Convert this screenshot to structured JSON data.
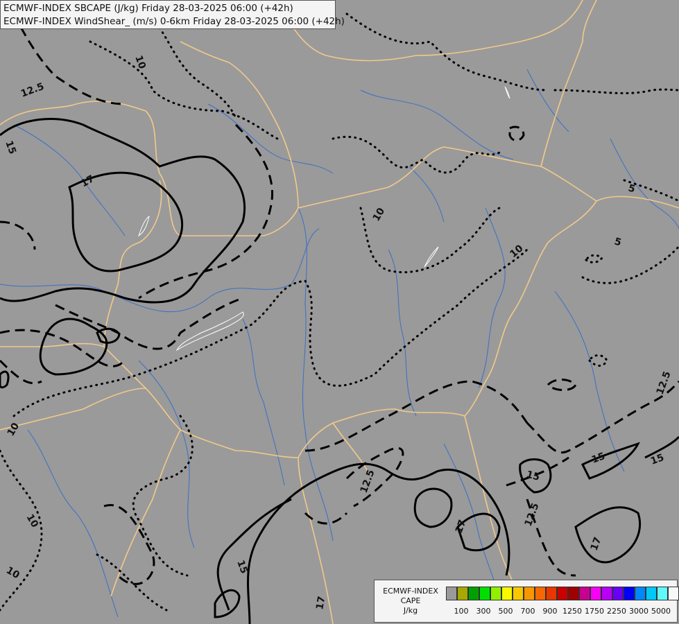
{
  "header": {
    "line1": "ECMWF-INDEX SBCAPE (J/kg) Friday 28-03-2025 06:00 (+42h)",
    "line2": "ECMWF-INDEX WindShear_ (m/s) 0-6km Friday 28-03-2025 06:00 (+42h)"
  },
  "contour_labels": [
    "10",
    "12.5",
    "15",
    "17",
    "10",
    "10",
    "5",
    "5",
    "12.5",
    "15",
    "15",
    "17",
    "15",
    "17",
    "12.5",
    "12.5",
    "17",
    "15",
    "17",
    "10",
    "10",
    "10"
  ],
  "legend": {
    "title_line1": "ECMWF-INDEX",
    "title_line2": "CAPE",
    "title_line3": "J/kg",
    "colors": [
      "#9a9a9a",
      "#a8a800",
      "#00a000",
      "#00e000",
      "#90f000",
      "#f8f800",
      "#f8c800",
      "#f89800",
      "#f86800",
      "#e83800",
      "#c80000",
      "#a00000",
      "#c80090",
      "#f800f8",
      "#b800f8",
      "#6800f8",
      "#0000f8",
      "#0088f8",
      "#00c8f8",
      "#60f8f8",
      "#f8f8f8"
    ],
    "ticks": [
      "100",
      "300",
      "500",
      "700",
      "900",
      "1250",
      "1750",
      "2250",
      "3000",
      "5000"
    ]
  },
  "colors": {
    "background": "#9a9a9a",
    "borders": "#f2c98a",
    "rivers": "#3a6fc4",
    "contours": "#000000"
  }
}
